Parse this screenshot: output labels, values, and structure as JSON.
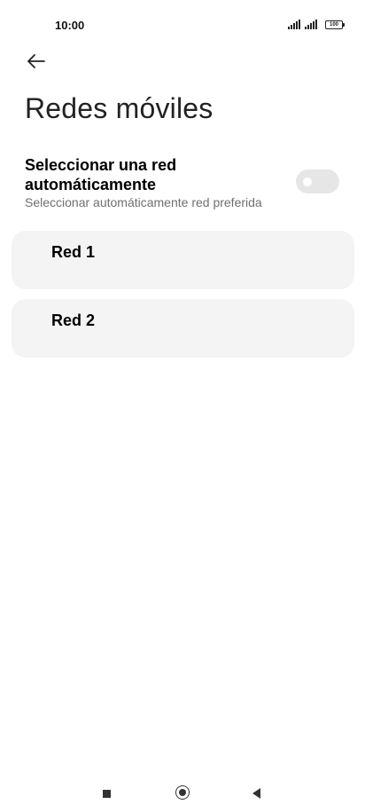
{
  "status_bar": {
    "time": "10:00",
    "battery": "100"
  },
  "header": {
    "title": "Redes móviles"
  },
  "auto_select": {
    "title": "Seleccionar una red automáticamente",
    "subtitle": "Seleccionar automáticamente red preferida",
    "enabled": false
  },
  "networks": [
    {
      "label": "Red 1"
    },
    {
      "label": "Red 2"
    }
  ],
  "nav": {
    "icons": [
      "recents-icon",
      "home-icon",
      "back-icon"
    ]
  },
  "colors": {
    "card_bg": "#f4f4f4",
    "toggle_off": "#e6e6e6",
    "subtitle_text": "#6f6f6f"
  }
}
